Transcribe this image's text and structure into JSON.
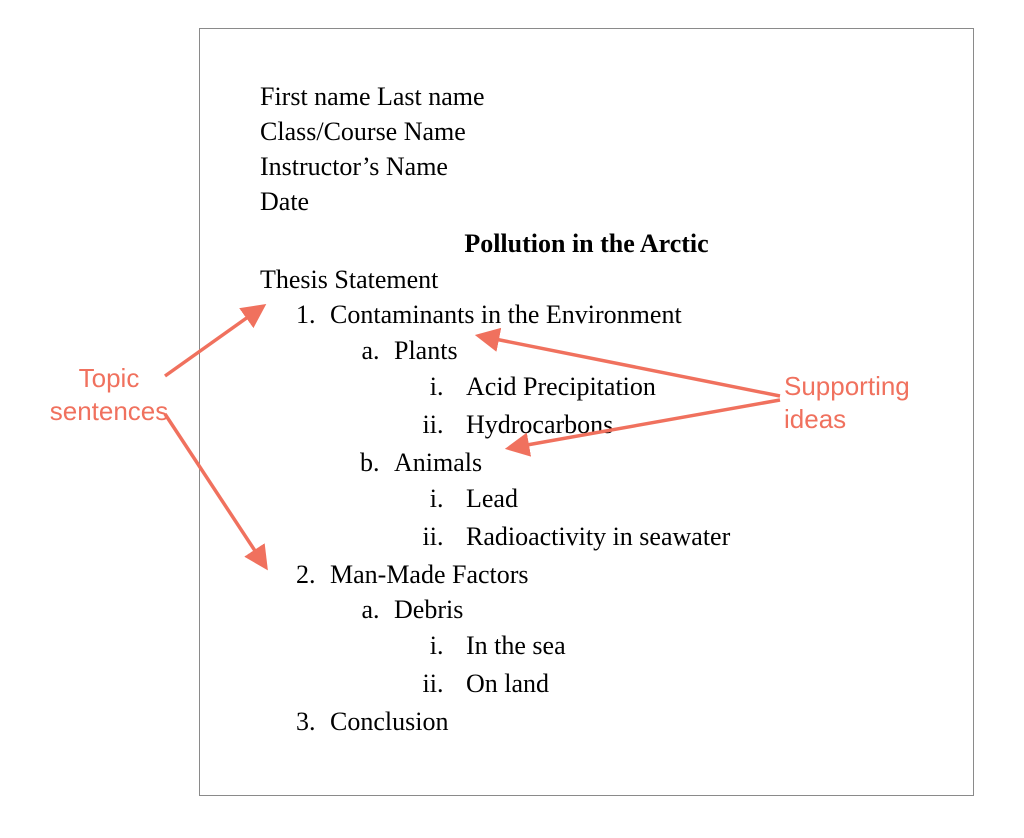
{
  "header": {
    "line1": "First name Last name",
    "line2": "Class/Course Name",
    "line3": "Instructor’s Name",
    "line4": "Date"
  },
  "title": "Pollution in the Arctic",
  "thesis_label": "Thesis Statement",
  "outline": {
    "item1": {
      "text": "Contaminants in the Environment",
      "a": {
        "text": "Plants",
        "i": "Acid Precipitation",
        "ii": "Hydrocarbons"
      },
      "b": {
        "text": "Animals",
        "i": "Lead",
        "ii": "Radioactivity in seawater"
      }
    },
    "item2": {
      "text": "Man-Made Factors",
      "a": {
        "text": "Debris",
        "i": "In the sea",
        "ii": "On land"
      }
    },
    "item3": {
      "text": "Conclusion"
    }
  },
  "annotations": {
    "topic_sentences_l1": "Topic",
    "topic_sentences_l2": "sentences",
    "supporting_l1": "Supporting",
    "supporting_l2": "ideas"
  },
  "colors": {
    "annotation": "#f0715e",
    "border": "#8a8a8a"
  }
}
